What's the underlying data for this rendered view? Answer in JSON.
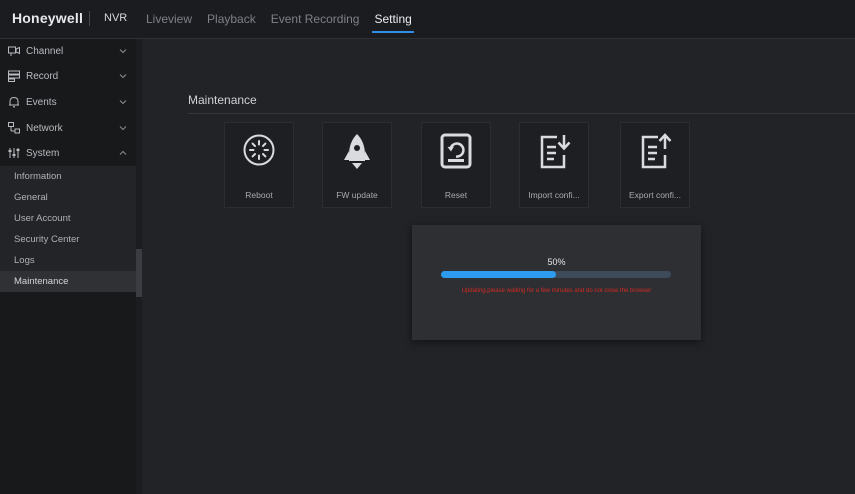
{
  "header": {
    "brand": "Honeywell",
    "product": "NVR",
    "nav": [
      "Liveview",
      "Playback",
      "Event Recording",
      "Setting"
    ],
    "active_nav": "Setting"
  },
  "sidebar": {
    "groups": [
      {
        "label": "Channel",
        "icon": "camera-icon",
        "expanded": false
      },
      {
        "label": "Record",
        "icon": "record-icon",
        "expanded": false
      },
      {
        "label": "Events",
        "icon": "bell-icon",
        "expanded": false
      },
      {
        "label": "Network",
        "icon": "network-icon",
        "expanded": false
      },
      {
        "label": "System",
        "icon": "sliders-icon",
        "expanded": true
      }
    ],
    "system_items": [
      "Information",
      "General",
      "User Account",
      "Security Center",
      "Logs",
      "Maintenance"
    ],
    "active_item": "Maintenance"
  },
  "main": {
    "section_title": "Maintenance",
    "tiles": [
      {
        "label": "Reboot",
        "icon": "reboot-icon"
      },
      {
        "label": "FW update",
        "icon": "rocket-icon"
      },
      {
        "label": "Reset",
        "icon": "reset-icon"
      },
      {
        "label": "Import confi...",
        "icon": "import-config-icon"
      },
      {
        "label": "Export confi...",
        "icon": "export-config-icon"
      }
    ]
  },
  "dialog": {
    "percent_text": "50%",
    "progress": 0.5,
    "message": "Updating,please waiting for a few minutes and do not close the browser"
  },
  "colors": {
    "accent": "#2f8fe6",
    "progress_fill": "#2c9bf0",
    "warning": "#d42a24"
  }
}
